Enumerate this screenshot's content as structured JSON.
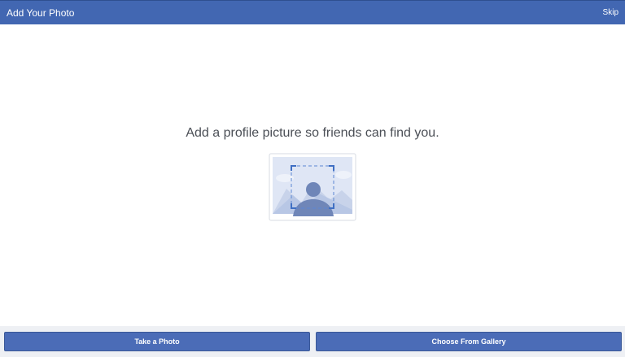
{
  "header": {
    "title": "Add Your Photo",
    "skip_label": "Skip"
  },
  "main": {
    "prompt": "Add a profile picture so friends can find you.",
    "illustration_icon": "profile-photo-placeholder-icon"
  },
  "actions": {
    "take_photo_label": "Take a Photo",
    "gallery_label": "Choose From Gallery"
  },
  "colors": {
    "brand_blue": "#4267b2",
    "button_blue": "#4b6cb7",
    "text_gray": "#4b4f56",
    "bottom_bar": "#eef0f4"
  }
}
